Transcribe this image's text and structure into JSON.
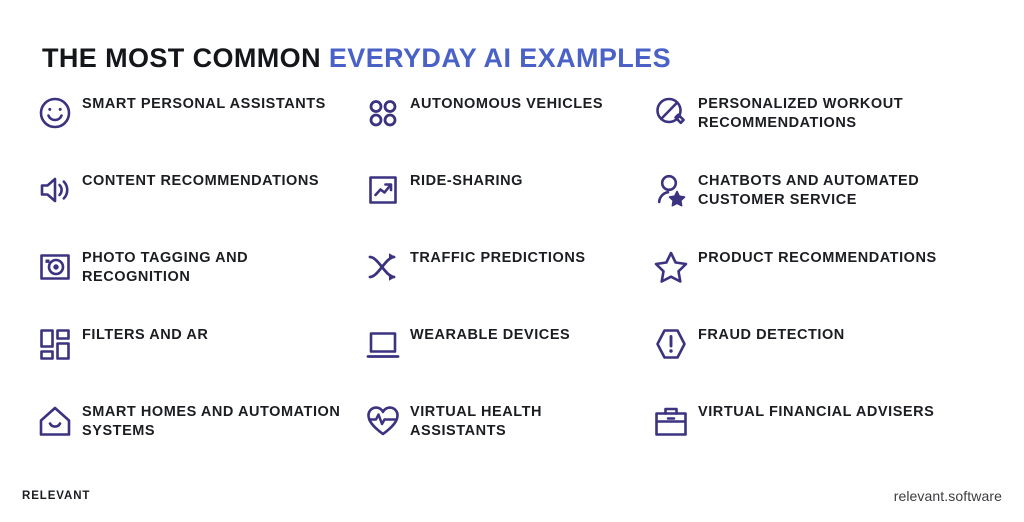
{
  "heading": {
    "part_dark": "THE MOST COMMON ",
    "part_accent": "EVERYDAY AI EXAMPLES"
  },
  "colors": {
    "accent_blue": "#4a62c8",
    "icon_purple": "#3b3280",
    "text_dark": "#1b1d21",
    "background": "#ffffff"
  },
  "columns": [
    {
      "id": "column-1",
      "items": [
        {
          "icon": "smiley-face-icon",
          "label": "SMART PERSONAL ASSISTANTS"
        },
        {
          "icon": "speaker-volume-icon",
          "label": "CONTENT RECOMMENDATIONS"
        },
        {
          "icon": "camera-icon",
          "label": "PHOTO TAGGING AND RECOGNITION"
        },
        {
          "icon": "grid-layout-icon",
          "label": "FILTERS AND AR"
        },
        {
          "icon": "smart-home-icon",
          "label": "SMART HOMES AND AUTOMATION SYSTEMS"
        }
      ]
    },
    {
      "id": "column-2",
      "items": [
        {
          "icon": "four-dots-icon",
          "label": "AUTONOMOUS VEHICLES"
        },
        {
          "icon": "chart-arrow-up-icon",
          "label": "RIDE-SHARING"
        },
        {
          "icon": "shuffle-arrows-icon",
          "label": "TRAFFIC PREDICTIONS"
        },
        {
          "icon": "laptop-icon",
          "label": "WEARABLE DEVICES"
        },
        {
          "icon": "heart-pulse-icon",
          "label": "VIRTUAL HEALTH ASSISTANTS"
        }
      ]
    },
    {
      "id": "column-3",
      "items": [
        {
          "icon": "table-tennis-paddle-icon",
          "label": "PERSONALIZED WORKOUT RECOMMENDATIONS"
        },
        {
          "icon": "person-star-icon",
          "label": "CHATBOTS AND AUTOMATED CUSTOMER SERVICE"
        },
        {
          "icon": "star-outline-icon",
          "label": "PRODUCT RECOMMENDATIONS"
        },
        {
          "icon": "alert-hexagon-icon",
          "label": "FRAUD DETECTION"
        },
        {
          "icon": "briefcase-icon",
          "label": "VIRTUAL FINANCIAL ADVISERS"
        }
      ]
    }
  ],
  "footer": {
    "logo": "RELEVANT",
    "website": "relevant.software"
  }
}
